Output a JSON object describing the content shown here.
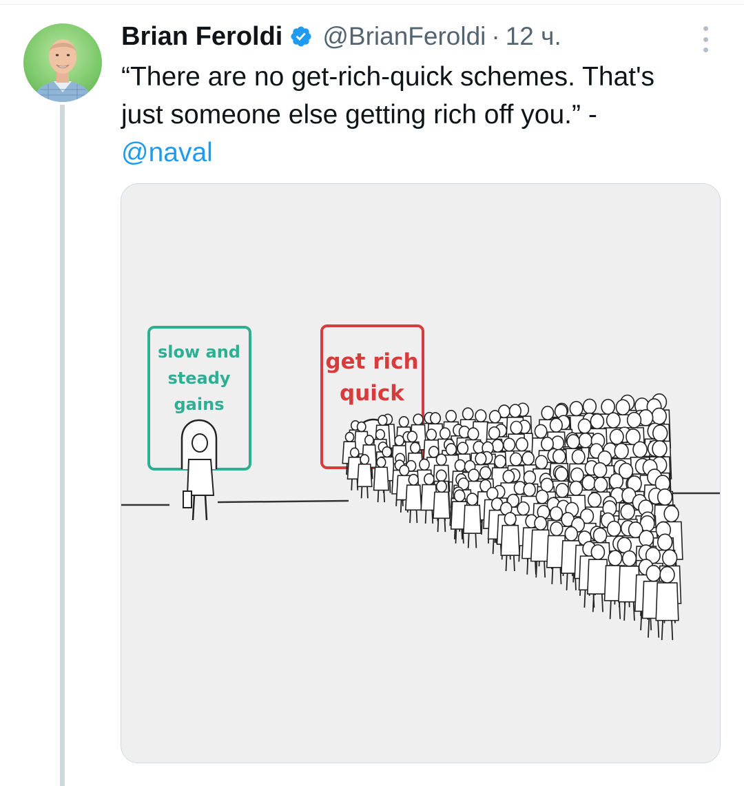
{
  "tweet": {
    "author_name": "Brian Feroldi",
    "handle": "@BrianFeroldi",
    "separator": "·",
    "time": "12 ч.",
    "text_line1": "“There are no get-rich-quick schemes. That's",
    "text_line2": "just someone else getting rich off you.” -",
    "mention": "@naval"
  },
  "image": {
    "left_door_sign": [
      "slow and",
      "steady",
      "gains"
    ],
    "right_door_sign": [
      "get rich",
      "quick"
    ]
  },
  "colors": {
    "link": "#1d9bf0",
    "verified": "#1d9bf0",
    "secondary_text": "#536471",
    "left_sign": "#2fae94",
    "right_sign": "#d63c3c"
  },
  "icons": {
    "verified": "verified-badge-icon",
    "more": "more-vertical-icon"
  }
}
